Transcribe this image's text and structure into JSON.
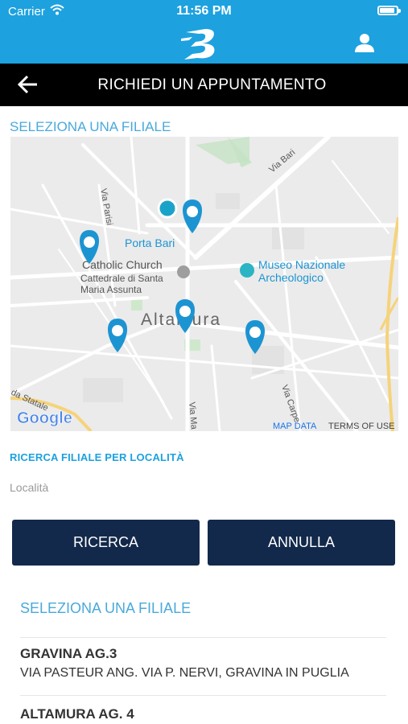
{
  "status_bar": {
    "carrier": "Carrier",
    "time": "11:56 PM"
  },
  "header": {
    "logo_icon": "brand-logo-icon",
    "user_icon": "user-icon"
  },
  "title_bar": {
    "back_icon": "arrow-left-icon",
    "title": "RICHIEDI UN APPUNTAMENTO"
  },
  "map_section": {
    "label": "SELEZIONA UNA FILIALE",
    "streets": [
      "Via Bari",
      "Via Parisi",
      "Via Carpe",
      "Via Ma",
      "da Statale"
    ],
    "places": {
      "porta_bari": "Porta Bari",
      "church_en": "Catholic Church",
      "church_it_1": "Cattedrale di Santa",
      "church_it_2": "Maria Assunta",
      "museum_1": "Museo Nazionale",
      "museum_2": "Archeologico",
      "town": "Altamura"
    },
    "attribution": {
      "logo": "Google",
      "map_data": "MAP DATA",
      "terms": "TERMS OF USE"
    },
    "markers": 5
  },
  "search": {
    "label": "RICERCA FILIALE PER LOCALITÀ",
    "placeholder": "Località",
    "value": "",
    "search_button": "RICERCA",
    "cancel_button": "ANNULLA"
  },
  "branches": {
    "header": "SELEZIONA UNA FILIALE",
    "items": [
      {
        "name": "GRAVINA AG.3",
        "address": "VIA PASTEUR ANG. VIA P. NERVI, GRAVINA IN PUGLIA"
      },
      {
        "name": "ALTAMURA AG. 4",
        "address": ""
      }
    ]
  },
  "colors": {
    "header_blue": "#1da1df",
    "title_black": "#000000",
    "button_navy": "#13294b",
    "label_blue": "#4aa9dc"
  }
}
